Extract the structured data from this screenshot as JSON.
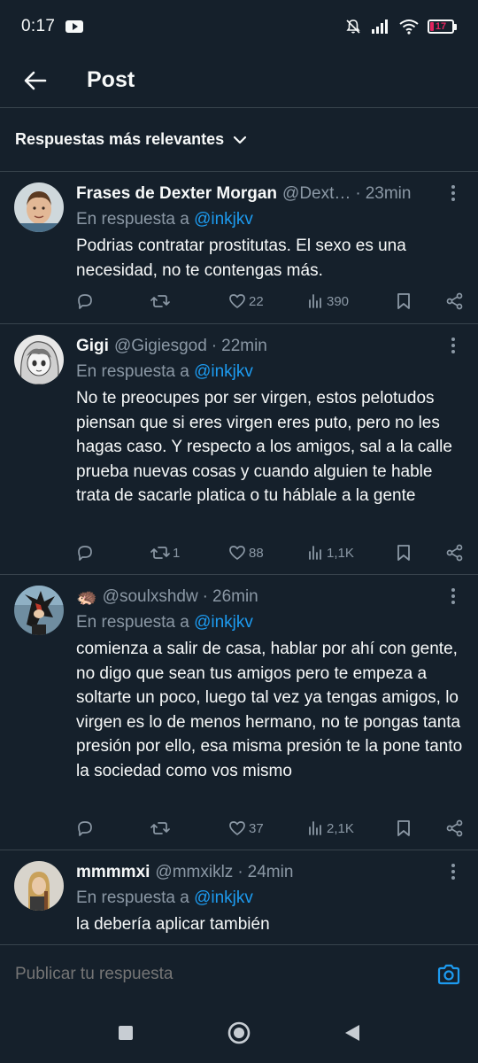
{
  "status_bar": {
    "time": "0:17",
    "battery": "17",
    "battery_level": 0.17,
    "icons": [
      "youtube-icon",
      "mute-bell-icon",
      "signal-icon",
      "wifi-icon",
      "battery-icon"
    ]
  },
  "header": {
    "title": "Post"
  },
  "sort": {
    "label": "Respuestas más relevantes"
  },
  "replies": [
    {
      "name": "Frases de Dexter Morgan",
      "handle": "@Dext…",
      "time": "23min",
      "in_reply_prefix": "En respuesta a",
      "in_reply_mention": "@inkjkv",
      "text": "Podrias contratar prostitutas. El sexo es una necesidad, no te contengas más.",
      "retweets": "",
      "likes": "22",
      "views": "390"
    },
    {
      "name": "Gigi",
      "handle": "@Gigiesgod",
      "time": "22min",
      "in_reply_prefix": "En respuesta a",
      "in_reply_mention": "@inkjkv",
      "text": "No te preocupes por ser virgen, estos pelotudos piensan que si eres virgen eres puto, pero no les hagas caso. Y respecto a los amigos, sal a la calle prueba nuevas cosas y cuando alguien te hable trata de sacarle platica o tu háblale a la gente",
      "retweets": "1",
      "likes": "88",
      "views": "1,1K"
    },
    {
      "name": "🦔",
      "handle": "@soulxshdw",
      "time": "26min",
      "in_reply_prefix": "En respuesta a",
      "in_reply_mention": "@inkjkv",
      "text": "comienza a salir de casa, hablar por ahí con gente, no digo que sean tus amigos pero te empeza a soltarte un poco, luego tal vez ya tengas amigos,  lo virgen es lo de menos hermano, no te pongas tanta presión por ello, esa misma presión te la pone tanto la sociedad como vos mismo",
      "retweets": "",
      "likes": "37",
      "views": "2,1K"
    },
    {
      "name": "mmmmxi",
      "handle": "@mmxiklz",
      "time": "24min",
      "in_reply_prefix": "En respuesta a",
      "in_reply_mention": "@inkjkv",
      "text": "la debería aplicar también"
    }
  ],
  "compose": {
    "placeholder": "Publicar tu respuesta"
  },
  "colors": {
    "background": "#15202b",
    "accent": "#1d9bf0",
    "muted": "#8b98a5",
    "divider": "#38444d"
  }
}
